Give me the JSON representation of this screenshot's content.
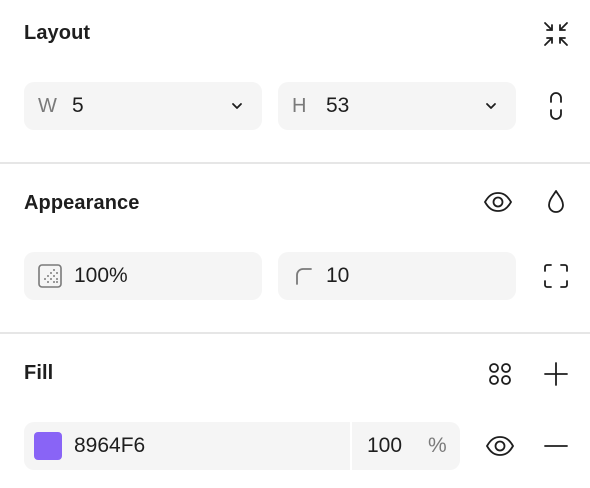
{
  "layout": {
    "title": "Layout",
    "width": {
      "prefix": "W",
      "value": "5"
    },
    "height": {
      "prefix": "H",
      "value": "53"
    }
  },
  "appearance": {
    "title": "Appearance",
    "opacity": "100%",
    "radius": "10"
  },
  "fill": {
    "title": "Fill",
    "hex": "8964F6",
    "color": "#8964F6",
    "opacity": "100",
    "percent_sign": "%"
  },
  "icons": {
    "collapse": "collapse-arrows-icon",
    "constrain": "link-proportions-icon",
    "visibility": "eye-icon",
    "blend": "drop-icon",
    "corners": "independent-corners-icon",
    "styles": "styles-grid-icon",
    "add": "plus-icon",
    "remove": "minus-icon"
  }
}
